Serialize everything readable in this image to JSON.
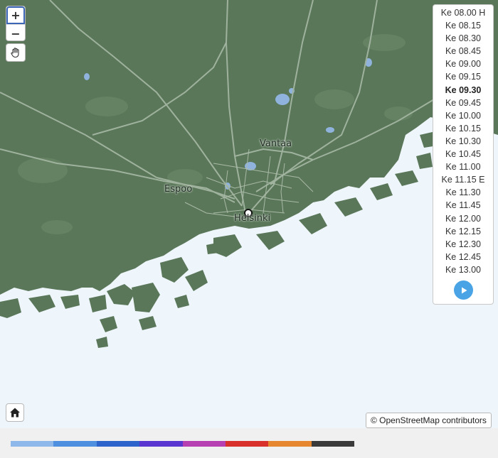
{
  "map": {
    "city_labels": [
      "Vantaa",
      "Espoo",
      "Helsinki"
    ],
    "zoom_in_label": "+",
    "zoom_out_label": "−",
    "pan_icon": "hand-icon",
    "home_icon": "home-icon",
    "attribution": "© OpenStreetMap contributors"
  },
  "time_selector": {
    "times": [
      "Ke 08.00 H",
      "Ke 08.15",
      "Ke 08.30",
      "Ke 08.45",
      "Ke 09.00",
      "Ke 09.15",
      "Ke 09.30",
      "Ke 09.45",
      "Ke 10.00",
      "Ke 10.15",
      "Ke 10.30",
      "Ke 10.45",
      "Ke 11.00",
      "Ke 11.15 E",
      "Ke 11.30",
      "Ke 11.45",
      "Ke 12.00",
      "Ke 12.15",
      "Ke 12.30",
      "Ke 12.45",
      "Ke 13.00"
    ],
    "selected": "Ke 09.30",
    "play_icon": "play-icon"
  },
  "legend": {
    "colors": [
      "#8fb8ea",
      "#4e8fe0",
      "#2c64cc",
      "#5a36d1",
      "#b63fb2",
      "#d8302a",
      "#e6862e",
      "#3a3a3a"
    ]
  },
  "colors": {
    "land": "#5a7759",
    "sea": "#eef6fc",
    "road": "#9fb29d",
    "lake": "#8fb3dc"
  }
}
